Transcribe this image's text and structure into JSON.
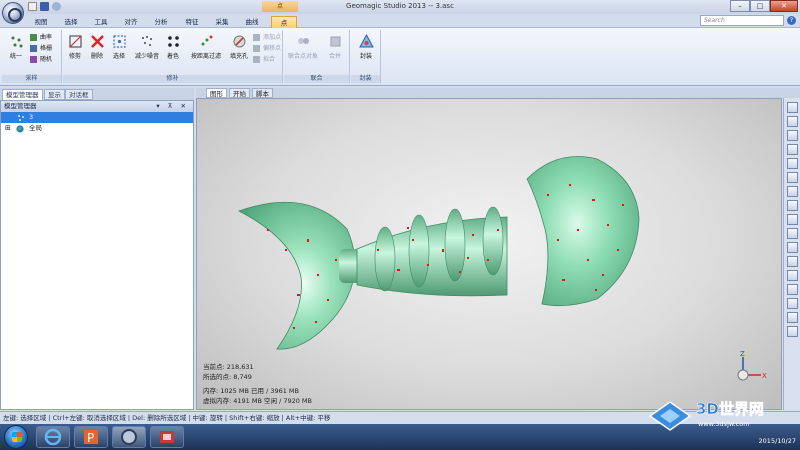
{
  "window": {
    "title": "Geomagic Studio 2013 -- 3.asc",
    "context_tab_title": "点"
  },
  "ribbon_tabs": [
    {
      "label": "视图"
    },
    {
      "label": "选择"
    },
    {
      "label": "工具"
    },
    {
      "label": "对齐"
    },
    {
      "label": "分析"
    },
    {
      "label": "特征"
    },
    {
      "label": "采集"
    },
    {
      "label": "曲线"
    },
    {
      "label": "点"
    }
  ],
  "search": {
    "placeholder": "Search"
  },
  "ribbon": {
    "groups": [
      {
        "label": "采样"
      },
      {
        "label": "修补"
      },
      {
        "label": "联合"
      },
      {
        "label": "封装"
      }
    ],
    "buttons": {
      "unify": "统一",
      "curvature": "曲率",
      "grid": "格栅",
      "random": "随机",
      "trim": "修剪",
      "delete": "删除",
      "select": "选择",
      "reduce_noise": "减少噪音",
      "shade": "着色",
      "distance_filter": "按距离过滤",
      "fill_holes": "填充孔",
      "add_points": "添加点",
      "offset_points": "偏移点",
      "fit": "拟合",
      "merge_objects": "联合点对象",
      "combine": "合并",
      "wrap": "封装"
    }
  },
  "left_panel": {
    "tabs": [
      "模型管理器",
      "显示",
      "对话框"
    ],
    "header": "模型管理器",
    "header_controls": "▾ ⊼ ✕",
    "tree": [
      {
        "label": "3",
        "selected": true
      },
      {
        "label": "全局",
        "selected": false
      }
    ]
  },
  "viewport": {
    "tabs": [
      "图形",
      "开始",
      "脚本"
    ],
    "stats": {
      "current_points": "当前点: 218,631",
      "selected_points": "所选的点: 8,749",
      "memory": "内存: 1025 MB 已用 / 3961 MB",
      "virtual_memory": "虚拟内存: 4191 MB 空闲 / 7920 MB"
    },
    "axis": {
      "z": "Z",
      "x": "X"
    }
  },
  "statusbar": {
    "text": "左键: 选择区域 | Ctrl+左键: 取消选择区域 | Del: 删除所选区域 | 中键: 旋转 | Shift+右键: 缩放 | Alt+中键: 平移"
  },
  "taskbar": {
    "date": "2015/10/27"
  },
  "watermark": {
    "text": "3D世界网",
    "url": "www.3dsjw.com"
  },
  "colors": {
    "mesh": "#7fd4a8",
    "selection": "#d41c1c",
    "accent": "#2f7fe0"
  }
}
